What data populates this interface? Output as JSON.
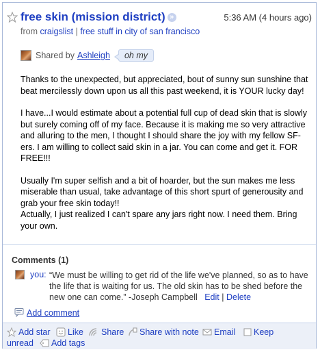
{
  "item": {
    "title": "free skin (mission district)",
    "timestamp": "5:36 AM (4 hours ago)",
    "source_prefix": "from",
    "source_name": "craigslist",
    "source_separator": "|",
    "source_feed": "free stuff in city of san francisco",
    "shared_by_label": "Shared by",
    "sharer": "Ashleigh",
    "share_note": "oh my",
    "body_paragraphs": [
      "Thanks to the unexpected, but appreciated, bout of sunny sun sunshine that beat mercilessly down upon us all this past weekend, it is YOUR lucky day!",
      "I have...I would estimate about a potential full cup of dead skin that is slowly but surely coming off of my face. Because it is making me so very attractive and alluring to the men, I thought I should share the joy with my fellow SF-ers. I am willing to collect said skin in a jar. You can come and get it. FOR FREE!!!",
      "Usually I'm super selfish and a bit of hoarder, but the sun makes me less miserable than usual, take advantage of this short spurt of generousity and grab your free skin today!!",
      "Actually, I just realized I can't spare any jars right now. I need them. Bring your own."
    ]
  },
  "comments": {
    "title": "Comments (1)",
    "entries": [
      {
        "author": "you:",
        "text": "“We must be willing to get rid of the life we've planned, so as to have the life that is waiting for us. The old skin has to be shed before the new one can come.” -Joseph Campbell",
        "edit_label": "Edit",
        "separator": "|",
        "delete_label": "Delete"
      }
    ],
    "add_comment_label": "Add comment"
  },
  "actions": {
    "add_star": "Add star",
    "like": "Like",
    "share": "Share",
    "share_with_note": "Share with note",
    "email": "Email",
    "keep_unread": "Keep unread",
    "add_tags": "Add tags"
  },
  "colors": {
    "link": "#1f3fc2",
    "border": "#a9b9d9",
    "footer_bg": "#ecf0f8",
    "note_bg": "#e5ecf9"
  }
}
